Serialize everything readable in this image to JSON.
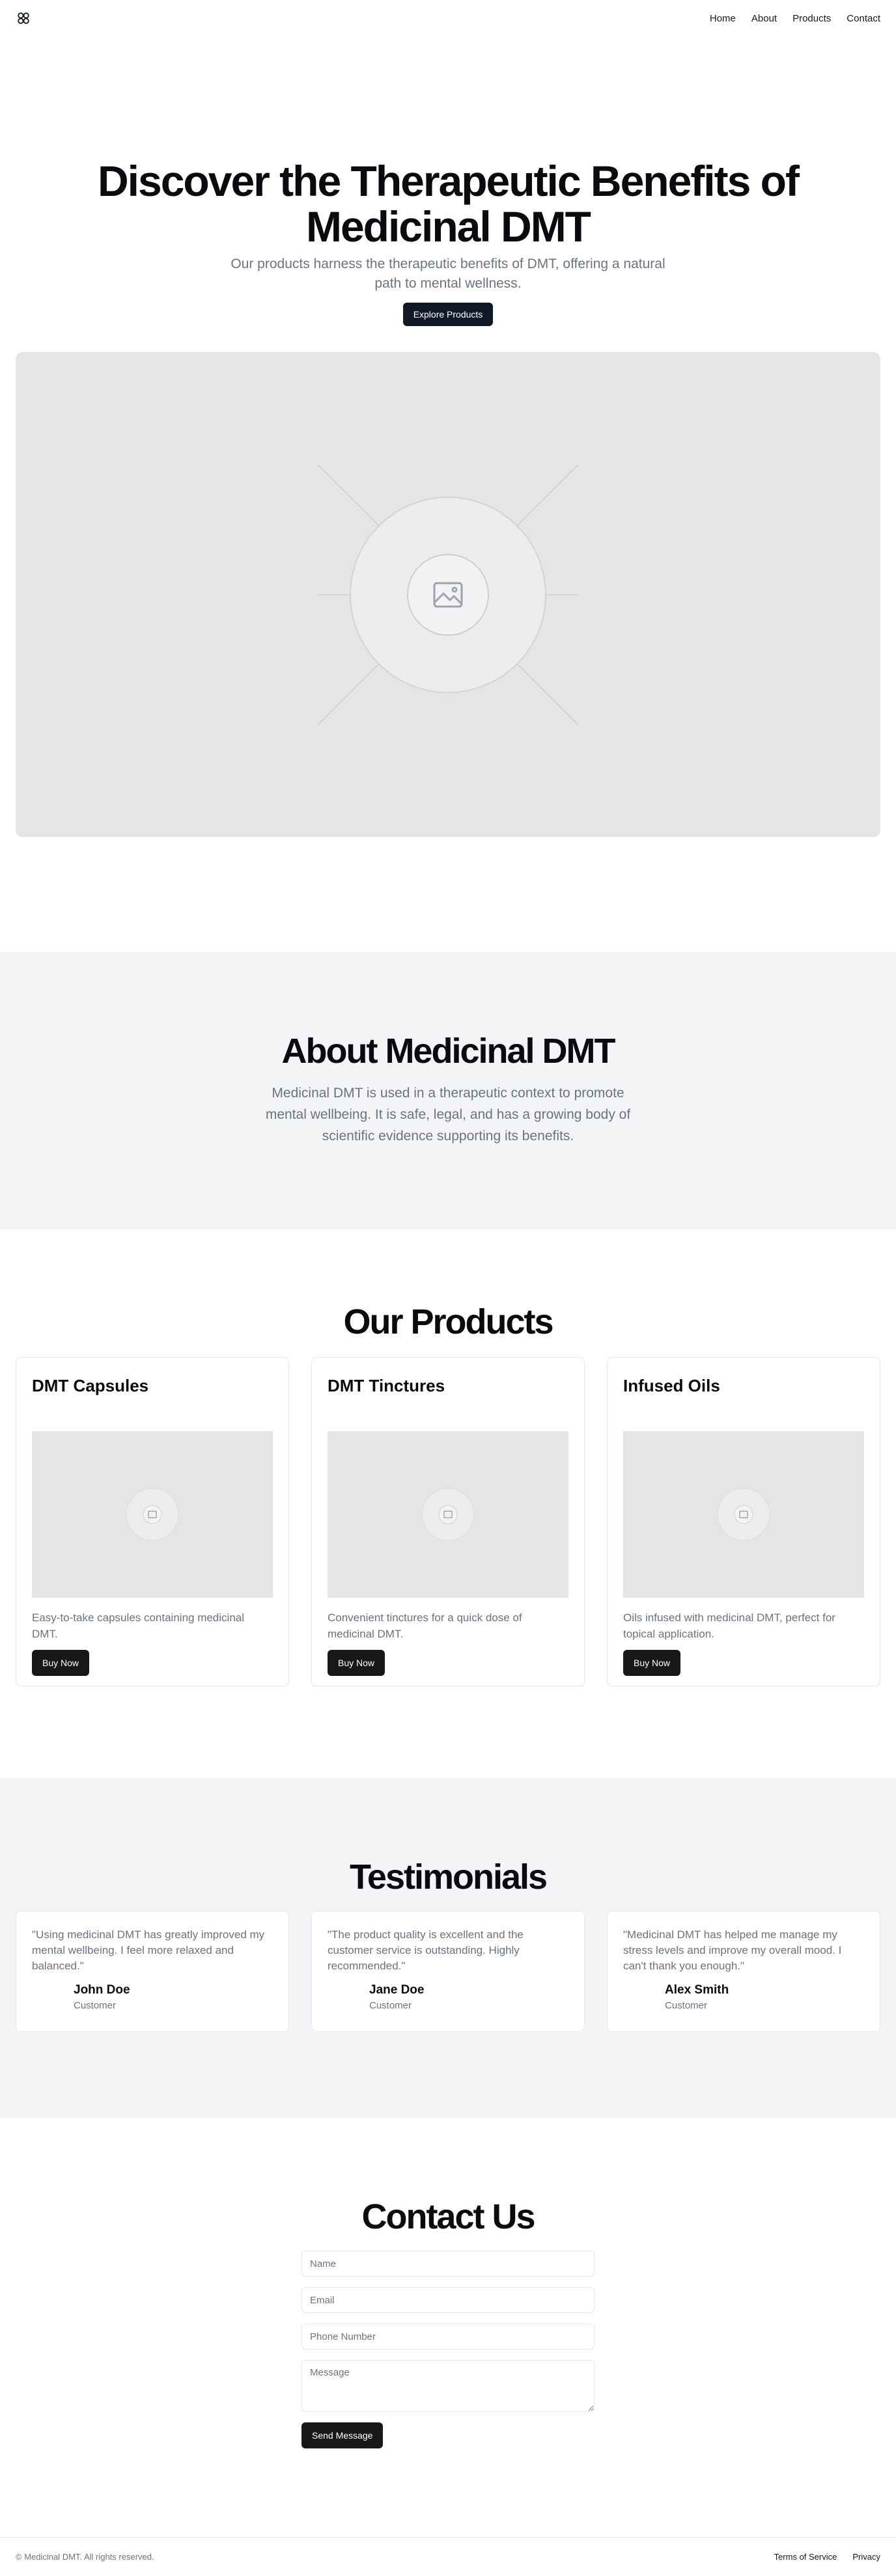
{
  "header": {
    "logo_icon": "lattice-logo-icon",
    "nav": [
      {
        "label": "Home"
      },
      {
        "label": "About"
      },
      {
        "label": "Products"
      },
      {
        "label": "Contact"
      }
    ]
  },
  "hero": {
    "title": "Discover the Therapeutic Benefits of Medicinal DMT",
    "subtitle": "Our products harness the therapeutic benefits of DMT, offering a natural path to mental wellness.",
    "cta_label": "Explore Products",
    "image_icon": "image-placeholder-icon"
  },
  "about": {
    "title": "About Medicinal DMT",
    "text": "Medicinal DMT is used in a therapeutic context to promote mental wellbeing. It is safe, legal, and has a growing body of scientific evidence supporting its benefits."
  },
  "products": {
    "title": "Our Products",
    "items": [
      {
        "name": "DMT Capsules",
        "description": "Easy-to-take capsules containing medicinal DMT.",
        "button": "Buy Now"
      },
      {
        "name": "DMT Tinctures",
        "description": "Convenient tinctures for a quick dose of medicinal DMT.",
        "button": "Buy Now"
      },
      {
        "name": "Infused Oils",
        "description": "Oils infused with medicinal DMT, perfect for topical application.",
        "button": "Buy Now"
      }
    ]
  },
  "testimonials": {
    "title": "Testimonials",
    "items": [
      {
        "quote": "\"Using medicinal DMT has greatly improved my mental wellbeing. I feel more relaxed and balanced.\"",
        "name": "John Doe",
        "role": "Customer"
      },
      {
        "quote": "\"The product quality is excellent and the customer service is outstanding. Highly recommended.\"",
        "name": "Jane Doe",
        "role": "Customer"
      },
      {
        "quote": "\"Medicinal DMT has helped me manage my stress levels and improve my overall mood. I can't thank you enough.\"",
        "name": "Alex Smith",
        "role": "Customer"
      }
    ]
  },
  "contact": {
    "title": "Contact Us",
    "name_placeholder": "Name",
    "email_placeholder": "Email",
    "phone_placeholder": "Phone Number",
    "message_placeholder": "Message",
    "submit_label": "Send Message"
  },
  "footer": {
    "copyright": "© Medicinal DMT. All rights reserved.",
    "links": [
      {
        "label": "Terms of Service"
      },
      {
        "label": "Privacy"
      }
    ]
  }
}
